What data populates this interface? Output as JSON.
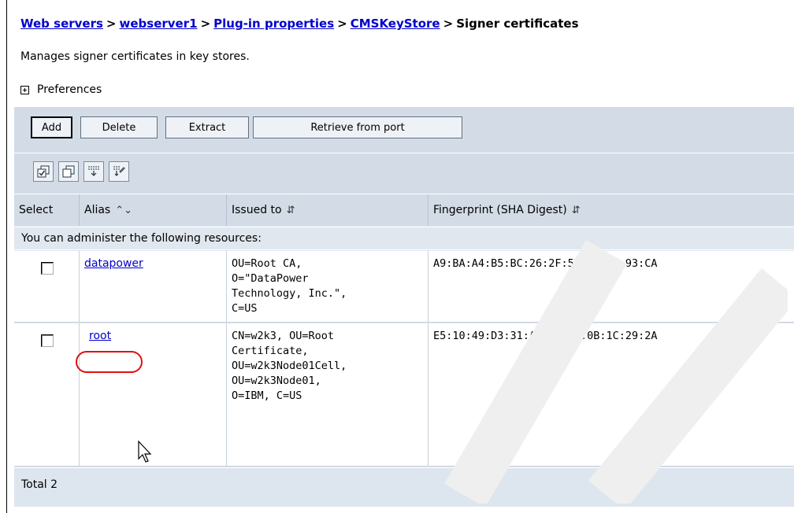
{
  "breadcrumb": {
    "items": [
      "Web servers",
      "webserver1",
      "Plug-in properties",
      "CMSKeyStore"
    ],
    "separator": ">",
    "current": "Signer certificates"
  },
  "description": "Manages signer certificates in key stores.",
  "preferences": {
    "label": "Preferences",
    "icon": "expand-plus-icon"
  },
  "toolbar": {
    "add": "Add",
    "delete": "Delete",
    "extract": "Extract",
    "retrieve": "Retrieve from port"
  },
  "icon_toolbar": [
    "select-all-icon",
    "deselect-all-icon",
    "show-filter-icon",
    "clear-filter-icon"
  ],
  "table": {
    "headers": {
      "select": "Select",
      "alias": "Alias",
      "issued_to": "Issued to",
      "fingerprint": "Fingerprint (SHA Digest)"
    },
    "resources_label": "You can administer the following resources:",
    "rows": [
      {
        "alias": "datapower",
        "issued_to": [
          "OU=Root CA,",
          "O=\"DataPower",
          "Technology, Inc.\",",
          "C=US"
        ],
        "fingerprint": "A9:BA:A4:B5:BC:26:2F:5D:2A:80:93:CA"
      },
      {
        "alias": "root",
        "issued_to": [
          "CN=w2k3, OU=Root",
          "Certificate,",
          "OU=w2k3Node01Cell,",
          "OU=w2k3Node01,",
          "O=IBM, C=US"
        ],
        "fingerprint": "E5:10:49:D3:31:A3:8D:57:0B:1C:29:2A"
      }
    ],
    "total": "Total 2"
  },
  "colors": {
    "link": "#0000cc",
    "table_bg": "#dde5ee",
    "highlight_ring": "#e01010"
  }
}
